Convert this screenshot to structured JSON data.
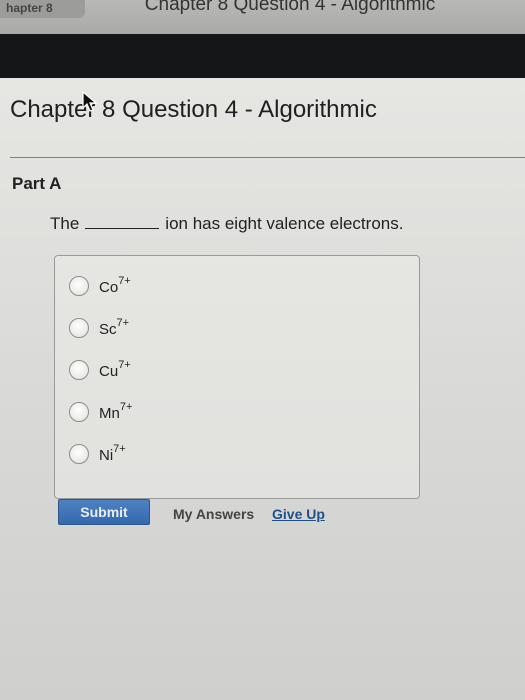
{
  "browser": {
    "tab_left_label": "hapter 8",
    "tab_title": "Chapter 8 Question 4 - Algorithmic"
  },
  "page": {
    "title": "Chapter 8 Question 4 - Algorithmic",
    "part_label": "Part A",
    "question_before": "The",
    "question_after": "ion has eight valence electrons."
  },
  "choices": [
    {
      "symbol": "Co",
      "charge": "7+"
    },
    {
      "symbol": "Sc",
      "charge": "7+"
    },
    {
      "symbol": "Cu",
      "charge": "7+"
    },
    {
      "symbol": "Mn",
      "charge": "7+"
    },
    {
      "symbol": "Ni",
      "charge": "7+"
    }
  ],
  "actions": {
    "submit_label": "Submit",
    "my_answers_label": "My Answers",
    "give_up_label": "Give Up"
  },
  "colors": {
    "submit_bg": "#3a6fb4",
    "link_blue": "#1f4f8c"
  },
  "icons": {
    "cursor": "mouse-pointer-icon"
  }
}
